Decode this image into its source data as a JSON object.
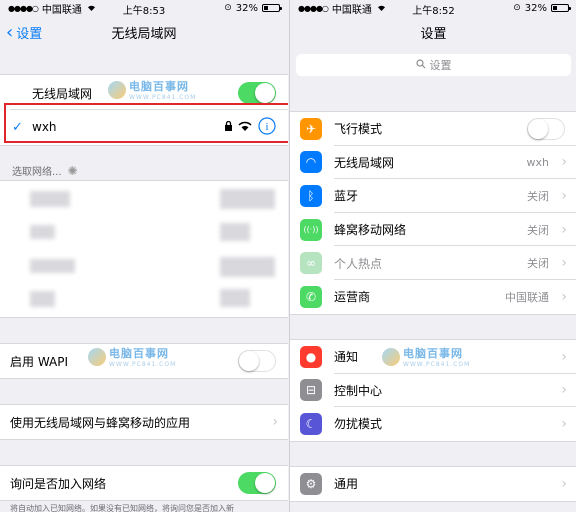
{
  "colors": {
    "accent": "#0a7cf5",
    "toggle_on": "#4cd964",
    "highlight": "#e0262b"
  },
  "left": {
    "status": {
      "carrier": "中国联通",
      "time": "上午8:53",
      "battery": "32%",
      "battery_level": 0.32
    },
    "nav": {
      "back_label": "设置",
      "title": "无线局域网"
    },
    "wifi_toggle": {
      "label": "无线局域网",
      "on": true
    },
    "connected_network": {
      "name": "wxh",
      "lock_icon": "lock-icon",
      "signal_icon": "wifi-icon",
      "info_icon": "info-icon"
    },
    "choose_network_header": "选取网络...",
    "wapi": {
      "label": "启用 WAPI",
      "on": false
    },
    "apps_using": {
      "label": "使用无线局域网与蜂窝移动的应用"
    },
    "ask_join": {
      "label": "询问是否加入网络",
      "on": true
    },
    "footer_text": "将自动加入已知网络。如果没有已知网络，将询问您是否加入新"
  },
  "right": {
    "status": {
      "carrier": "中国联通",
      "time": "上午8:52",
      "battery": "32%",
      "battery_level": 0.32
    },
    "nav": {
      "title": "设置"
    },
    "search_placeholder": "设置",
    "items": [
      {
        "label": "飞行模式",
        "icon": "airplane-icon",
        "color": "#ff9500",
        "toggle": false
      },
      {
        "label": "无线局域网",
        "icon": "wifi-icon",
        "color": "#007aff",
        "value": "wxh"
      },
      {
        "label": "蓝牙",
        "icon": "bluetooth-icon",
        "color": "#007aff",
        "value": "关闭"
      },
      {
        "label": "蜂窝移动网络",
        "icon": "cellular-icon",
        "color": "#4cd964",
        "value": "关闭"
      },
      {
        "label": "个人热点",
        "icon": "hotspot-icon",
        "color": "#b6e3c0",
        "value": "关闭",
        "dimmed": true
      },
      {
        "label": "运营商",
        "icon": "phone-icon",
        "color": "#4cd964",
        "value": "中国联通"
      },
      {
        "label": "通知",
        "icon": "notifications-icon",
        "color": "#ff3b30"
      },
      {
        "label": "控制中心",
        "icon": "control-center-icon",
        "color": "#8e8e93"
      },
      {
        "label": "勿扰模式",
        "icon": "moon-icon",
        "color": "#5856d6"
      },
      {
        "label": "通用",
        "icon": "gear-icon",
        "color": "#8e8e93"
      }
    ]
  },
  "watermark": {
    "main": "电脑百事网",
    "sub": "WWW.PC841.COM"
  }
}
